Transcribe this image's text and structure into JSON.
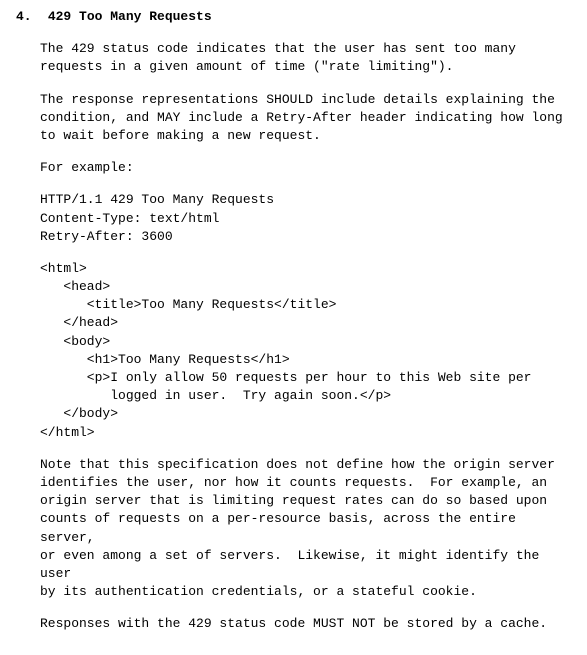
{
  "section": {
    "number": "4.",
    "title": "429 Too Many Requests"
  },
  "para1": "The 429 status code indicates that the user has sent too many\nrequests in a given amount of time (\"rate limiting\").",
  "para2": "The response representations SHOULD include details explaining the\ncondition, and MAY include a Retry-After header indicating how long\nto wait before making a new request.",
  "para3": "For example:",
  "code1": "HTTP/1.1 429 Too Many Requests\nContent-Type: text/html\nRetry-After: 3600",
  "code2": "<html>\n   <head>\n      <title>Too Many Requests</title>\n   </head>\n   <body>\n      <h1>Too Many Requests</h1>\n      <p>I only allow 50 requests per hour to this Web site per\n         logged in user.  Try again soon.</p>\n   </body>\n</html>",
  "para4": "Note that this specification does not define how the origin server\nidentifies the user, nor how it counts requests.  For example, an\norigin server that is limiting request rates can do so based upon\ncounts of requests on a per-resource basis, across the entire server,\nor even among a set of servers.  Likewise, it might identify the user\nby its authentication credentials, or a stateful cookie.",
  "para5": "Responses with the 429 status code MUST NOT be stored by a cache."
}
